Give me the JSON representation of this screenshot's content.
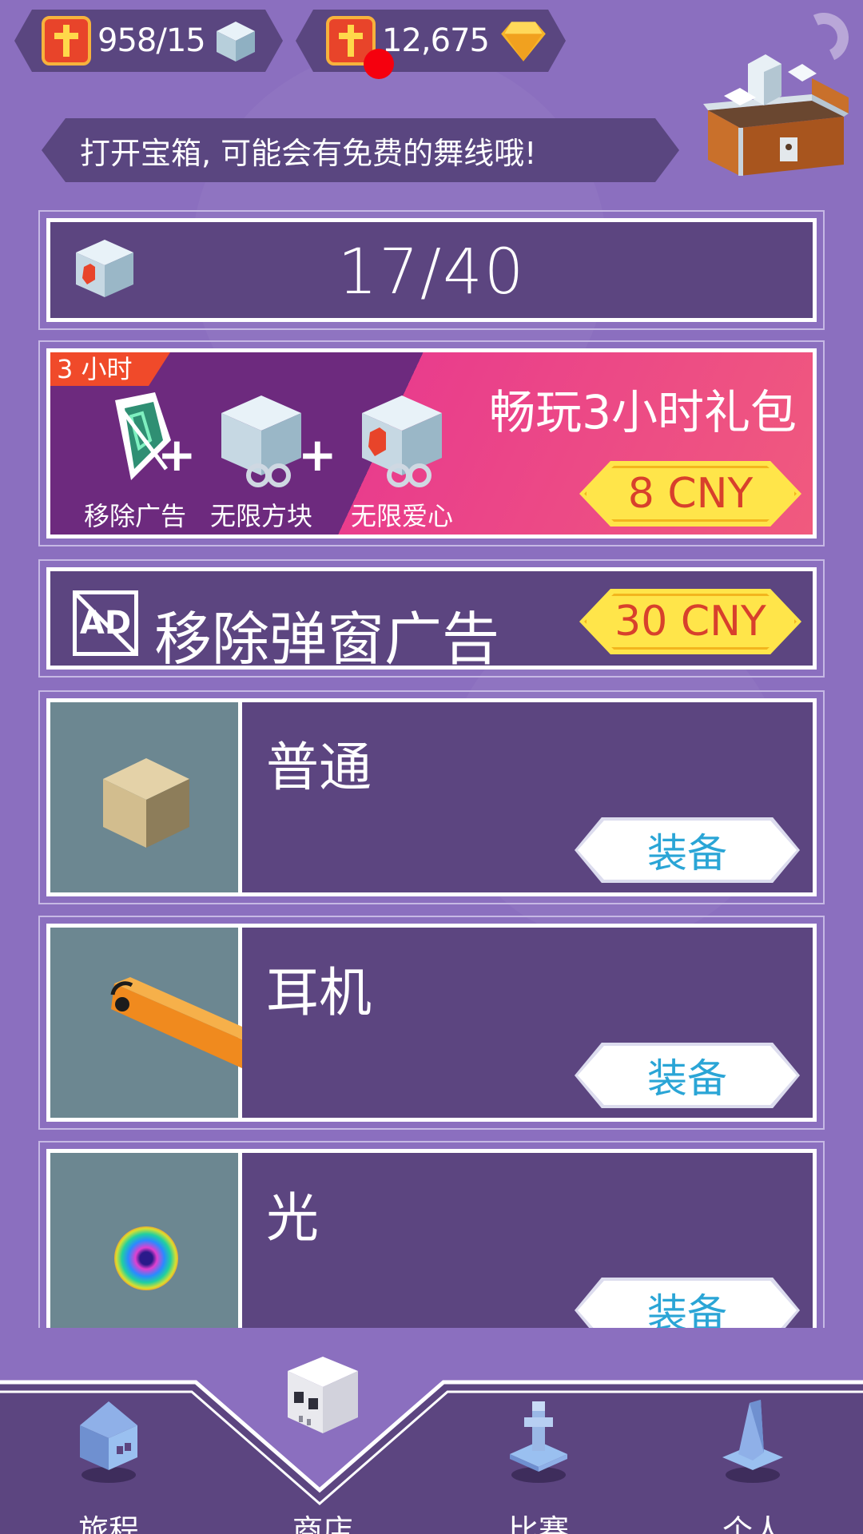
{
  "top_bar": {
    "lives_counter": "958/15",
    "gems_counter": "12,675",
    "icons": [
      "cross-icon",
      "ice-cube-icon",
      "cross-icon",
      "gold-gem-icon",
      "refresh-icon"
    ]
  },
  "banner": {
    "text": "打开宝箱, 可能会有免费的舞线哦!"
  },
  "lives_card": {
    "count": "17/40"
  },
  "offer": {
    "badge": "3 小时",
    "title": "畅玩3小时礼包",
    "price": "8 CNY",
    "items": [
      {
        "label": "移除广告"
      },
      {
        "label": "无限方块"
      },
      {
        "label": "无限爱心"
      }
    ]
  },
  "remove_ads": {
    "icon_text": "AD",
    "title": "移除弹窗广告",
    "price": "30 CNY"
  },
  "skins": [
    {
      "name": "普通",
      "button": "装备"
    },
    {
      "name": "耳机",
      "button": "装备"
    },
    {
      "name": "光",
      "button": "装备"
    }
  ],
  "nav": [
    {
      "label": "旅程",
      "icon": "house-icon"
    },
    {
      "label": "商店",
      "icon": "skull-icon"
    },
    {
      "label": "比赛",
      "icon": "trophy-icon"
    },
    {
      "label": "个人",
      "icon": "wizard-hat-icon"
    }
  ],
  "colors": {
    "background": "#8b6fbf",
    "panel": "#5c4580",
    "price_button": "#ffe54a",
    "price_text": "#d8402c",
    "equip_text": "#2aa5d6",
    "notification": "#f5000e"
  }
}
